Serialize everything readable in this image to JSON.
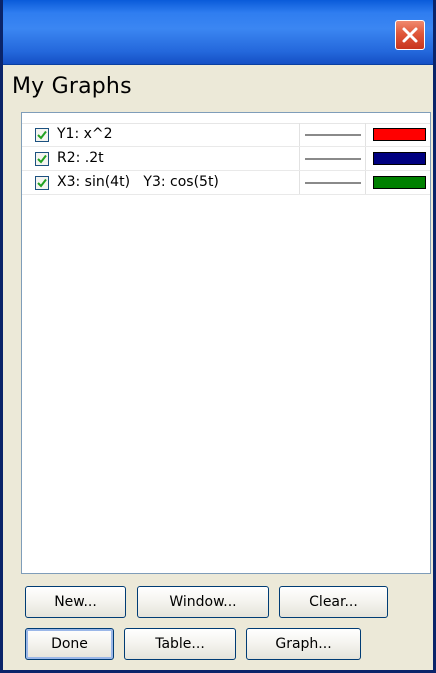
{
  "dialog": {
    "title": "My Graphs"
  },
  "graphs": [
    {
      "label": "Y1: x^2",
      "checked": true,
      "line_color": "#8a8a8a",
      "color": "#ff0000"
    },
    {
      "label": "R2: .2t",
      "checked": true,
      "line_color": "#8a8a8a",
      "color": "#000080"
    },
    {
      "label": "X3: sin(4t)   Y3: cos(5t)",
      "checked": true,
      "line_color": "#8a8a8a",
      "color": "#008000"
    }
  ],
  "buttons": {
    "new": "New...",
    "window": "Window...",
    "clear": "Clear...",
    "done": "Done",
    "table": "Table...",
    "graph": "Graph..."
  },
  "icons": {
    "close": "close-icon",
    "check": "check-icon"
  },
  "colors": {
    "titlebar": "#2f7df0",
    "close_button": "#e0573a",
    "window_bg": "#ece9d8",
    "checkmark": "#21a121"
  }
}
